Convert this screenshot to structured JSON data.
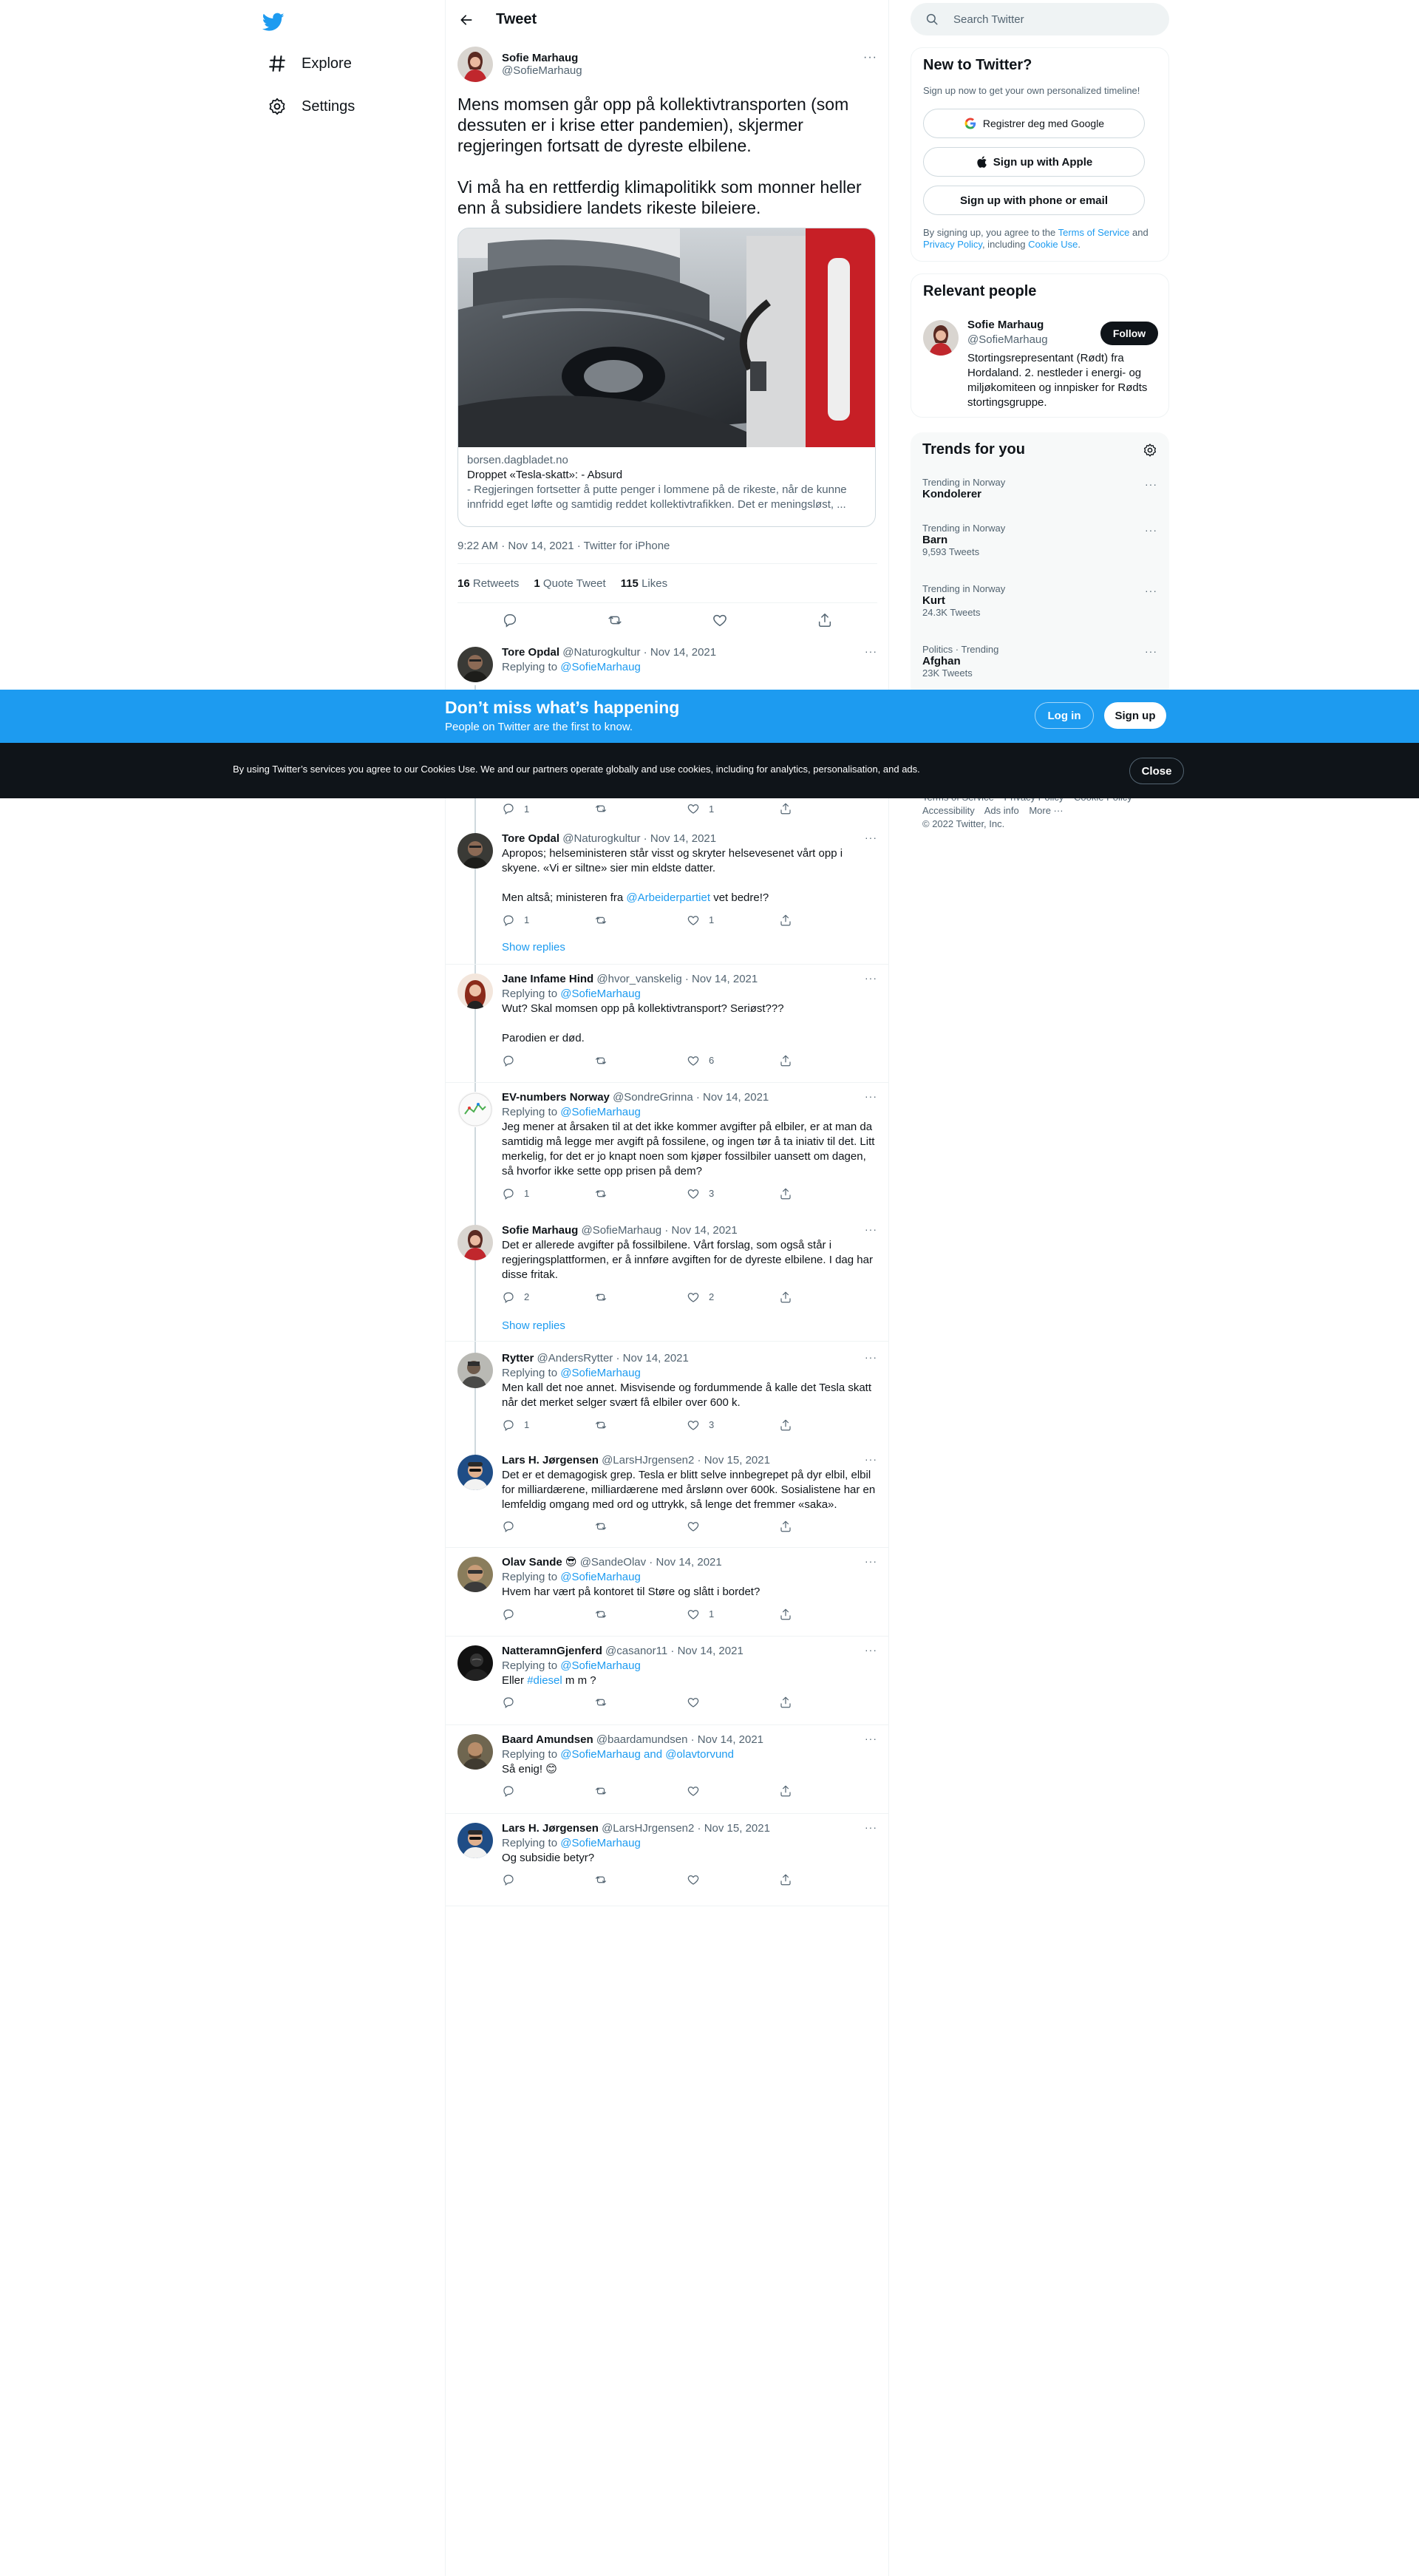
{
  "nav": {
    "explore": "Explore",
    "settings": "Settings"
  },
  "header": {
    "title": "Tweet"
  },
  "main_tweet": {
    "author_name": "Sofie Marhaug",
    "author_handle": "@SofieMarhaug",
    "text": "Mens momsen går opp på kollektivtransporten (som dessuten er i krise etter pandemien), skjermer regjeringen fortsatt de dyreste elbilene.\n\nVi må ha en rettferdig klimapolitikk som monner heller enn å subsidiere landets rikeste bileiere.",
    "card": {
      "domain": "borsen.dagbladet.no",
      "title": "Droppet «Tesla-skatt»: - Absurd",
      "description": "- Regjeringen fortsetter å putte penger i lommene på de rikeste, når de kunne innfridd eget løfte og samtidig reddet kollektivtrafikken. Det er meningsløst, ..."
    },
    "timestamp": "9:22 AM · Nov 14, 2021 · Twitter for iPhone",
    "stats": {
      "retweets_count": "16",
      "retweets_label": "Retweets",
      "quotes_count": "1",
      "quotes_label": "Quote Tweet",
      "likes_count": "115",
      "likes_label": "Likes"
    }
  },
  "replies": [
    {
      "name": "Tore Opdal",
      "handle": "@Naturogkultur",
      "date": "Nov 14, 2021",
      "replying_prefix": "Replying to ",
      "replying_to": "@SofieMarhaug",
      "text": "",
      "reply_count": "1",
      "retweet_count": "",
      "like_count": "1"
    },
    {
      "name": "Tore Opdal",
      "handle": "@Naturogkultur",
      "date": "Nov 14, 2021",
      "text_a": "Apropos; helseministeren står visst og skryter helsevesenet vårt opp i skyene. «Vi er siltne» sier min eldste datter.\n\nMen altså; ministeren fra ",
      "mention": "@Arbeiderpartiet",
      "text_b": " vet bedre!?",
      "reply_count": "1",
      "retweet_count": "",
      "like_count": "1"
    },
    {
      "name": "Jane Infame Hind",
      "handle": "@hvor_vanskelig",
      "date": "Nov 14, 2021",
      "replying_prefix": "Replying to ",
      "replying_to": "@SofieMarhaug",
      "text": "Wut? Skal momsen opp på kollektivtransport? Seriøst???\n\nParodien er død.",
      "reply_count": "",
      "retweet_count": "",
      "like_count": "6"
    },
    {
      "name": "EV-numbers Norway",
      "handle": "@SondreGrinna",
      "date": "Nov 14, 2021",
      "replying_prefix": "Replying to ",
      "replying_to": "@SofieMarhaug",
      "text": "Jeg mener at årsaken til at det ikke kommer avgifter på elbiler, er at man da samtidig må legge mer avgift på fossilene, og ingen tør å ta iniativ til det. Litt merkelig, for det er jo knapt noen som kjøper fossilbiler uansett om dagen, så hvorfor ikke sette opp prisen på dem?",
      "reply_count": "1",
      "retweet_count": "",
      "like_count": "3"
    },
    {
      "name": "Sofie Marhaug",
      "handle": "@SofieMarhaug",
      "date": "Nov 14, 2021",
      "text": "Det er allerede avgifter på fossilbilene. Vårt forslag, som også står i regjeringsplattformen, er å innføre avgiften for de dyreste elbilene. I dag har disse fritak.",
      "reply_count": "2",
      "retweet_count": "",
      "like_count": "2"
    },
    {
      "name": "Rytter",
      "handle": "@AndersRytter",
      "date": "Nov 14, 2021",
      "replying_prefix": "Replying to ",
      "replying_to": "@SofieMarhaug",
      "text": "Men kall det noe annet. Misvisende og fordummende å kalle det Tesla skatt når det merket selger svært få elbiler over 600 k.",
      "reply_count": "1",
      "retweet_count": "",
      "like_count": "3"
    },
    {
      "name": "Lars H. Jørgensen",
      "handle": "@LarsHJrgensen2",
      "date": "Nov 15, 2021",
      "text": "Det er et demagogisk grep. Tesla er blitt selve innbegrepet på dyr elbil, elbil for milliardærene, milliardærene med årslønn over 600k. Sosialistene har en lemfeldig omgang med ord og uttrykk, så lenge det fremmer «saka».",
      "reply_count": "",
      "retweet_count": "",
      "like_count": ""
    },
    {
      "name": "Olav Sande",
      "emoji": "😎",
      "handle": "@SandeOlav",
      "date": "Nov 14, 2021",
      "replying_prefix": "Replying to ",
      "replying_to": "@SofieMarhaug",
      "text": "Hvem har vært på kontoret til Støre og slått i bordet?",
      "reply_count": "",
      "retweet_count": "",
      "like_count": "1"
    },
    {
      "name": "NatteramnGjenferd",
      "handle": "@casanor11",
      "date": "Nov 14, 2021",
      "replying_prefix": "Replying to ",
      "replying_to": "@SofieMarhaug",
      "text_a": "Eller ",
      "hashtag": "#diesel",
      "text_b": " m m ?",
      "reply_count": "",
      "retweet_count": "",
      "like_count": ""
    },
    {
      "name": "Baard Amundsen",
      "handle": "@baardamundsen",
      "date": "Nov 14, 2021",
      "replying_prefix": "Replying to ",
      "replying_to": "@SofieMarhaug and @olavtorvund",
      "text": "Så enig! 😊",
      "reply_count": "",
      "retweet_count": "",
      "like_count": ""
    },
    {
      "name": "Lars H. Jørgensen",
      "handle": "@LarsHJrgensen2",
      "date": "Nov 15, 2021",
      "replying_prefix": "Replying to ",
      "replying_to": "@SofieMarhaug",
      "text": "Og subsidie betyr?",
      "reply_count": "",
      "retweet_count": "",
      "like_count": ""
    }
  ],
  "show_replies_label": "Show replies",
  "right": {
    "search_placeholder": "Search Twitter",
    "new_title": "New to Twitter?",
    "new_sub": "Sign up now to get your own personalized timeline!",
    "google_btn": "Registrer deg med Google",
    "apple_btn": "Sign up with Apple",
    "phone_btn": "Sign up with phone or email",
    "terms_a": "By signing up, you agree to the ",
    "terms_link": "Terms of Service",
    "terms_b": " and ",
    "privacy_link": "Privacy Policy",
    "terms_c": ", including ",
    "cookie_link": "Cookie Use",
    "terms_d": ".",
    "relevant_title": "Relevant people",
    "person_name": "Sofie Marhaug",
    "person_handle": "@SofieMarhaug",
    "follow": "Follow",
    "person_bio": "Stortingsrepresentant (Rødt) fra Hordaland. 2. nestleder i energi- og miljøkomiteen og innpisker for Rødts stortingsgruppe.",
    "trends_title": "Trends for you",
    "trends": [
      {
        "context": "Trending in Norway",
        "name": "Kondolerer",
        "count": ""
      },
      {
        "context": "Trending in Norway",
        "name": "Barn",
        "count": "9,593 Tweets"
      },
      {
        "context": "Trending in Norway",
        "name": "Kurt",
        "count": "24.3K Tweets"
      },
      {
        "context": "Politics · Trending",
        "name": "Afghan",
        "count": "23K Tweets"
      }
    ],
    "footer": {
      "terms": "Terms of Service",
      "privacy": "Privacy Policy",
      "cookie": "Cookie Policy",
      "accessibility": "Accessibility",
      "ads": "Ads info",
      "more": "More ···",
      "copyright": "© 2022 Twitter, Inc."
    }
  },
  "banner": {
    "title": "Don’t miss what’s happening",
    "subtitle": "People on Twitter are the first to know.",
    "login": "Log in",
    "signup": "Sign up"
  },
  "cookie": {
    "text": "By using Twitter’s services you agree to our Cookies Use. We and our partners operate globally and use cookies, including for analytics, personalisation, and ads.",
    "close": "Close"
  },
  "colors": {
    "accent": "#1d9bf0",
    "text": "#0f1419",
    "muted": "#536471",
    "dark": "#0f1419"
  }
}
